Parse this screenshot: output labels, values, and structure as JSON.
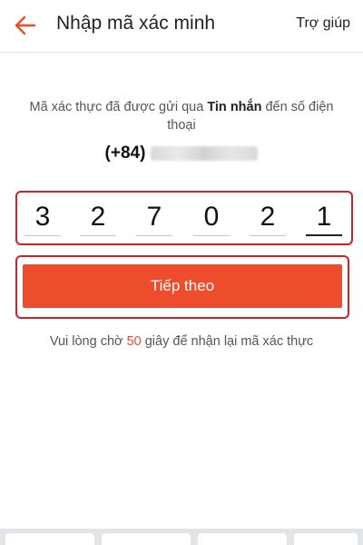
{
  "header": {
    "title": "Nhập mã xác minh",
    "help_label": "Trợ giúp",
    "back_icon": "arrow-left-icon"
  },
  "info": {
    "text_before": "Mã xác thực đã được gửi qua ",
    "bold": "Tin nhắn",
    "text_after": " đến số điện thoại"
  },
  "phone": {
    "prefix": "(+84)"
  },
  "otp": {
    "digits": [
      "3",
      "2",
      "7",
      "0",
      "2",
      "1"
    ]
  },
  "next_button": {
    "label": "Tiếp theo"
  },
  "resend": {
    "before": "Vui lòng chờ ",
    "seconds": "50",
    "after": " giây để nhận lại mã xác thực"
  },
  "colors": {
    "accent": "#ee4d2d",
    "highlight_border": "#d0202a"
  }
}
